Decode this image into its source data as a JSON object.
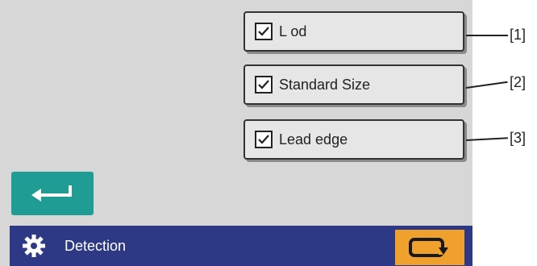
{
  "options": [
    {
      "label": "L  od",
      "checked": true
    },
    {
      "label": "Standard Size",
      "checked": true
    },
    {
      "label": "Lead edge",
      "checked": true
    }
  ],
  "callouts": [
    "[1]",
    "[2]",
    "[3]"
  ],
  "footer": {
    "title": "Detection",
    "icons": {
      "settings": "gear-icon",
      "cycle": "cycle-icon"
    }
  },
  "return_button": {
    "icon": "return-arrow-icon"
  },
  "colors": {
    "background": "#d7d7d7",
    "button_face": "#e6e6e6",
    "return_button": "#1f9c93",
    "status_bar": "#2d3984",
    "cycle_button": "#f0a02d"
  }
}
